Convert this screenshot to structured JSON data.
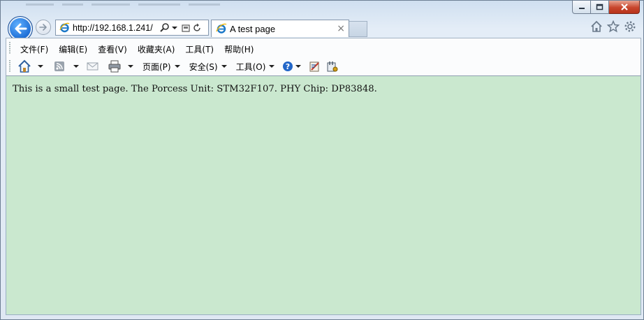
{
  "browser": {
    "address_url": "http://192.168.1.241/",
    "tab_title": "A test page",
    "tab_close": "×",
    "accent_color": "#1f6fd6"
  },
  "menu": {
    "items": [
      "文件(F)",
      "编辑(E)",
      "查看(V)",
      "收藏夹(A)",
      "工具(T)",
      "帮助(H)"
    ]
  },
  "command_bar": {
    "page_label": "页面(P)",
    "safety_label": "安全(S)",
    "tools_label": "工具(O)"
  },
  "page": {
    "text": "This is a small test page. The Porcess Unit: STM32F107. PHY Chip: DP83848.",
    "background": "#cae8cf"
  }
}
